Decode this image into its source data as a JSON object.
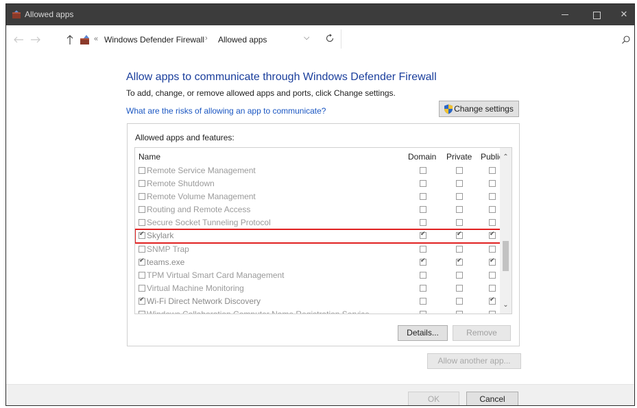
{
  "window": {
    "title": "Allowed apps"
  },
  "address_bar": {
    "overflow_marker": "«",
    "breadcrumbs": [
      "Windows Defender Firewall",
      "Allowed apps"
    ],
    "separator": "›"
  },
  "main": {
    "heading": "Allow apps to communicate through Windows Defender Firewall",
    "subtext": "To add, change, or remove allowed apps and ports, click Change settings.",
    "risk_link": "What are the risks of allowing an app to communicate?",
    "change_settings_label": "Change settings"
  },
  "apps_group": {
    "label": "Allowed apps and features:",
    "columns": {
      "name": "Name",
      "domain": "Domain",
      "private": "Private",
      "public": "Public"
    },
    "rows": [
      {
        "name": "Remote Service Management",
        "enabled": false,
        "domain": false,
        "private": false,
        "public": false
      },
      {
        "name": "Remote Shutdown",
        "enabled": false,
        "domain": false,
        "private": false,
        "public": false
      },
      {
        "name": "Remote Volume Management",
        "enabled": false,
        "domain": false,
        "private": false,
        "public": false
      },
      {
        "name": "Routing and Remote Access",
        "enabled": false,
        "domain": false,
        "private": false,
        "public": false
      },
      {
        "name": "Secure Socket Tunneling Protocol",
        "enabled": false,
        "domain": false,
        "private": false,
        "public": false
      },
      {
        "name": "Skylark",
        "enabled": true,
        "domain": true,
        "private": true,
        "public": true,
        "highlighted": true
      },
      {
        "name": "SNMP Trap",
        "enabled": false,
        "domain": false,
        "private": false,
        "public": false
      },
      {
        "name": "teams.exe",
        "enabled": true,
        "domain": true,
        "private": true,
        "public": true
      },
      {
        "name": "TPM Virtual Smart Card Management",
        "enabled": false,
        "domain": false,
        "private": false,
        "public": false
      },
      {
        "name": "Virtual Machine Monitoring",
        "enabled": false,
        "domain": false,
        "private": false,
        "public": false
      },
      {
        "name": "Wi-Fi Direct Network Discovery",
        "enabled": true,
        "domain": false,
        "private": false,
        "public": true
      },
      {
        "name": "Windows Collaboration Computer Name Registration Service",
        "enabled": false,
        "domain": false,
        "private": false,
        "public": false
      }
    ],
    "details_label": "Details...",
    "remove_label": "Remove"
  },
  "allow_another_label": "Allow another app...",
  "footer": {
    "ok_label": "OK",
    "cancel_label": "Cancel"
  },
  "colors": {
    "titlebar": "#3c3c3c",
    "heading": "#1a3e9c",
    "link": "#1a56c2",
    "highlight_border": "#e02020"
  }
}
